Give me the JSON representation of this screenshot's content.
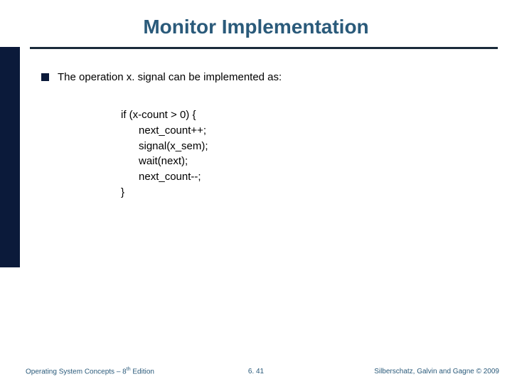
{
  "title": "Monitor Implementation",
  "bullet": {
    "pre": "The operation ",
    "op": "x. signal",
    "post": " can be implemented as:"
  },
  "code": {
    "l1": "if (x-count > 0) {",
    "l2": "      next_count++;",
    "l3": "      signal(x_sem);",
    "l4": "      wait(next);",
    "l5": "      next_count--;",
    "l6": "}"
  },
  "footer": {
    "left_pre": "Operating System Concepts – 8",
    "left_sup": "th",
    "left_post": " Edition",
    "center": "6. 41",
    "right": "Silberschatz, Galvin and Gagne © 2009"
  }
}
